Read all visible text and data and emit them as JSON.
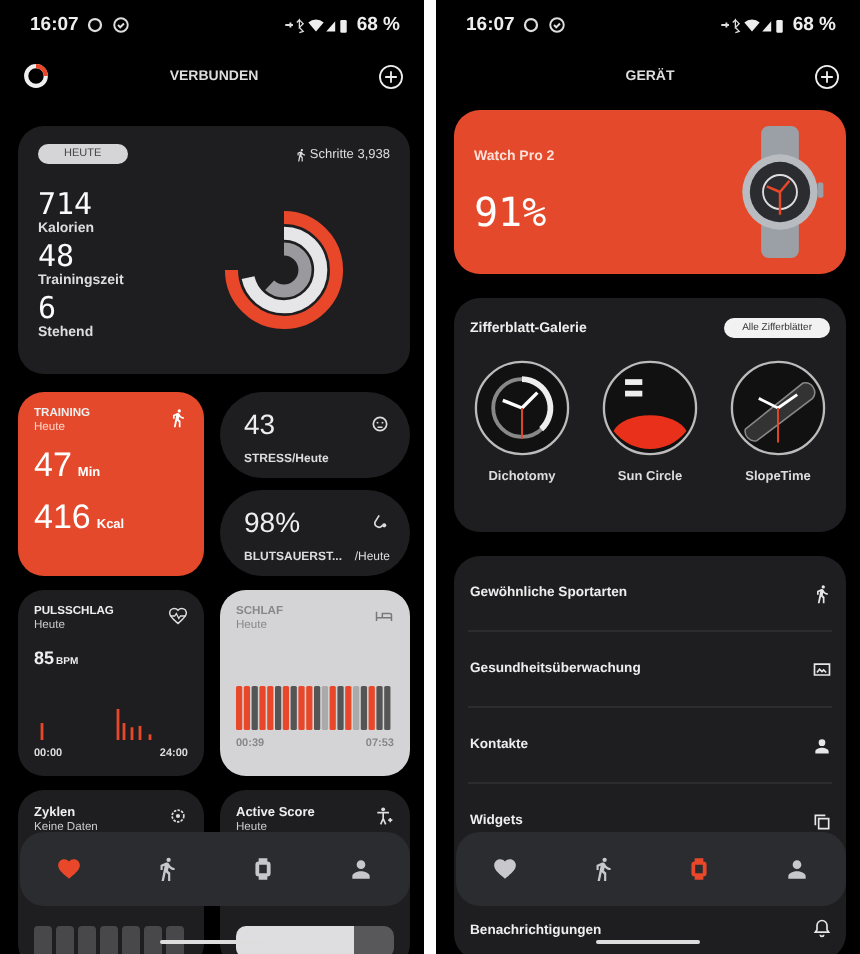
{
  "health_screen": {
    "status_bar": {
      "time": "16:07",
      "battery": "68 %"
    },
    "header": {
      "title": "VERBUNDEN"
    },
    "summary": {
      "badge": "HEUTE",
      "steps": "Schritte 3,938",
      "stats": [
        {
          "value": "714",
          "label": "Kalorien"
        },
        {
          "value": "48",
          "label": "Trainingszeit"
        },
        {
          "value": "6",
          "label": "Stehend"
        }
      ],
      "rings": [
        {
          "level": 0.75,
          "color": "#e8472a"
        },
        {
          "level": 0.72,
          "color": "#e6e6e8"
        },
        {
          "level": 0.62,
          "color": "#9a9a9e"
        }
      ]
    },
    "training": {
      "title": "TRAINING",
      "subtitle": "Heute",
      "values": [
        {
          "value": "47",
          "unit": "Min"
        },
        {
          "value": "416",
          "unit": "Kcal"
        }
      ]
    },
    "stress": {
      "value": "43",
      "label": "STRESS/Heute"
    },
    "blood_oxygen": {
      "value": "98%",
      "label": "BLUTSAUERST...",
      "suffix": "/Heute"
    },
    "pulse": {
      "title": "PULSSCHLAG",
      "subtitle": "Heute",
      "value": "85",
      "unit": "BPM",
      "start": "00:00",
      "end": "24:00"
    },
    "sleep": {
      "title": "SCHLAF",
      "subtitle": "Heute",
      "start": "00:39",
      "end": "07:53"
    },
    "cycles": {
      "title": "Zyklen",
      "subtitle": "Keine Daten"
    },
    "active_score": {
      "title": "Active Score",
      "subtitle": "Heute"
    },
    "nav": [
      {
        "kind": "heart",
        "selected": true
      },
      {
        "kind": "run",
        "selected": false
      },
      {
        "kind": "watch",
        "selected": false
      },
      {
        "kind": "person",
        "selected": false
      }
    ]
  },
  "device_screen": {
    "status_bar": {
      "time": "16:07",
      "battery": "68 %"
    },
    "header": {
      "title": "GERÄT"
    },
    "device": {
      "name": "Watch Pro 2",
      "battery": "91%"
    },
    "gallery": {
      "title": "Zifferblatt-Galerie",
      "button": "Alle Zifferblätter",
      "faces": [
        {
          "name": "Dichotomy",
          "kind": "dial"
        },
        {
          "name": "Sun Circle",
          "kind": "sun"
        },
        {
          "name": "SlopeTime",
          "kind": "slope"
        }
      ]
    },
    "menu": [
      {
        "label": "Gewöhnliche Sportarten",
        "kind": "run"
      },
      {
        "label": "Gesundheitsüberwachung",
        "kind": "health"
      },
      {
        "label": "Kontakte",
        "kind": "person"
      },
      {
        "label": "Widgets",
        "kind": "widgets"
      },
      {
        "label": "Benachrichtigungen",
        "kind": "bell"
      }
    ],
    "nav": [
      {
        "kind": "heart",
        "selected": false
      },
      {
        "kind": "run",
        "selected": false
      },
      {
        "kind": "watch",
        "selected": true
      },
      {
        "kind": "person",
        "selected": false
      }
    ]
  }
}
